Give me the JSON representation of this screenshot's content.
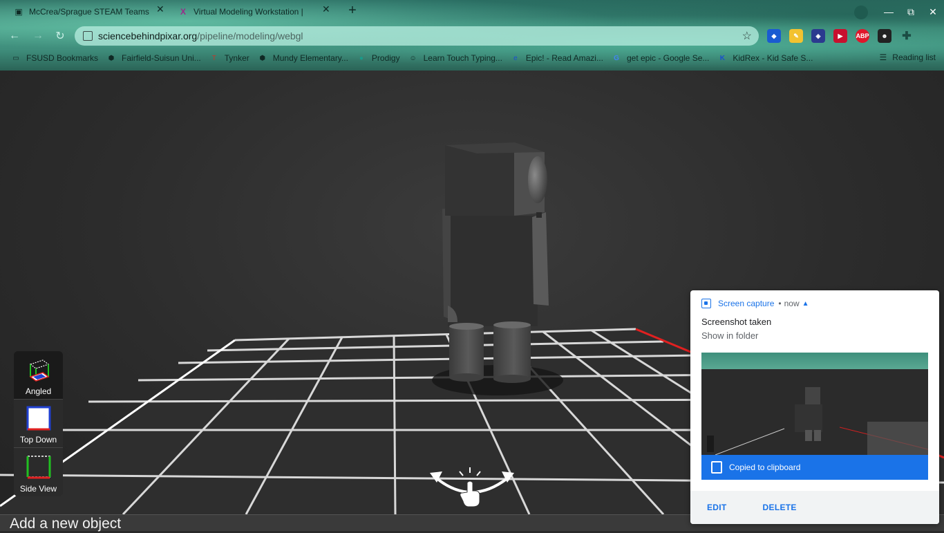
{
  "browser": {
    "tabs": [
      {
        "title": "McCrea/Sprague STEAM Teams",
        "icon": "teams-icon"
      },
      {
        "title": "Virtual Modeling Workstation |",
        "icon": "pixar-icon"
      }
    ],
    "new_tab": "+",
    "url_host": "sciencebehindpixar.org",
    "url_path": "/pipeline/modeling/webgl",
    "window_controls": {
      "minimize": "—",
      "maximize": "⧉",
      "close": "✕"
    },
    "extensions": [
      "shield-ext-icon",
      "pencil-ext-icon",
      "diamond-ext-icon",
      "video-ext-icon",
      "adblock-ext-icon",
      "ghost-ext-icon",
      "puzzle-icon"
    ],
    "adblock_label": "ABP",
    "bookmarks": [
      "FSUSD Bookmarks",
      "Fairfield-Suisun Uni...",
      "Tynker",
      "Mundy Elementary...",
      "Prodigy",
      "Learn Touch Typing...",
      "Epic! - Read Amazi...",
      "get epic - Google Se...",
      "KidRex - Kid Safe S..."
    ],
    "reading_list": "Reading list"
  },
  "app": {
    "views": [
      {
        "label": "Angled",
        "active": true
      },
      {
        "label": "Top Down",
        "active": false
      },
      {
        "label": "Side View",
        "active": false
      }
    ],
    "bottom_title": "Add a new object"
  },
  "notification": {
    "app": "Screen capture",
    "time": "now",
    "title": "Screenshot taken",
    "subtitle": "Show in folder",
    "clipboard": "Copied to clipboard",
    "actions": {
      "edit": "EDIT",
      "delete": "DELETE"
    }
  },
  "colors": {
    "accent": "#1a73e8",
    "viewport_bg": "#2a2a2a",
    "grid": "#d8d8d8"
  }
}
